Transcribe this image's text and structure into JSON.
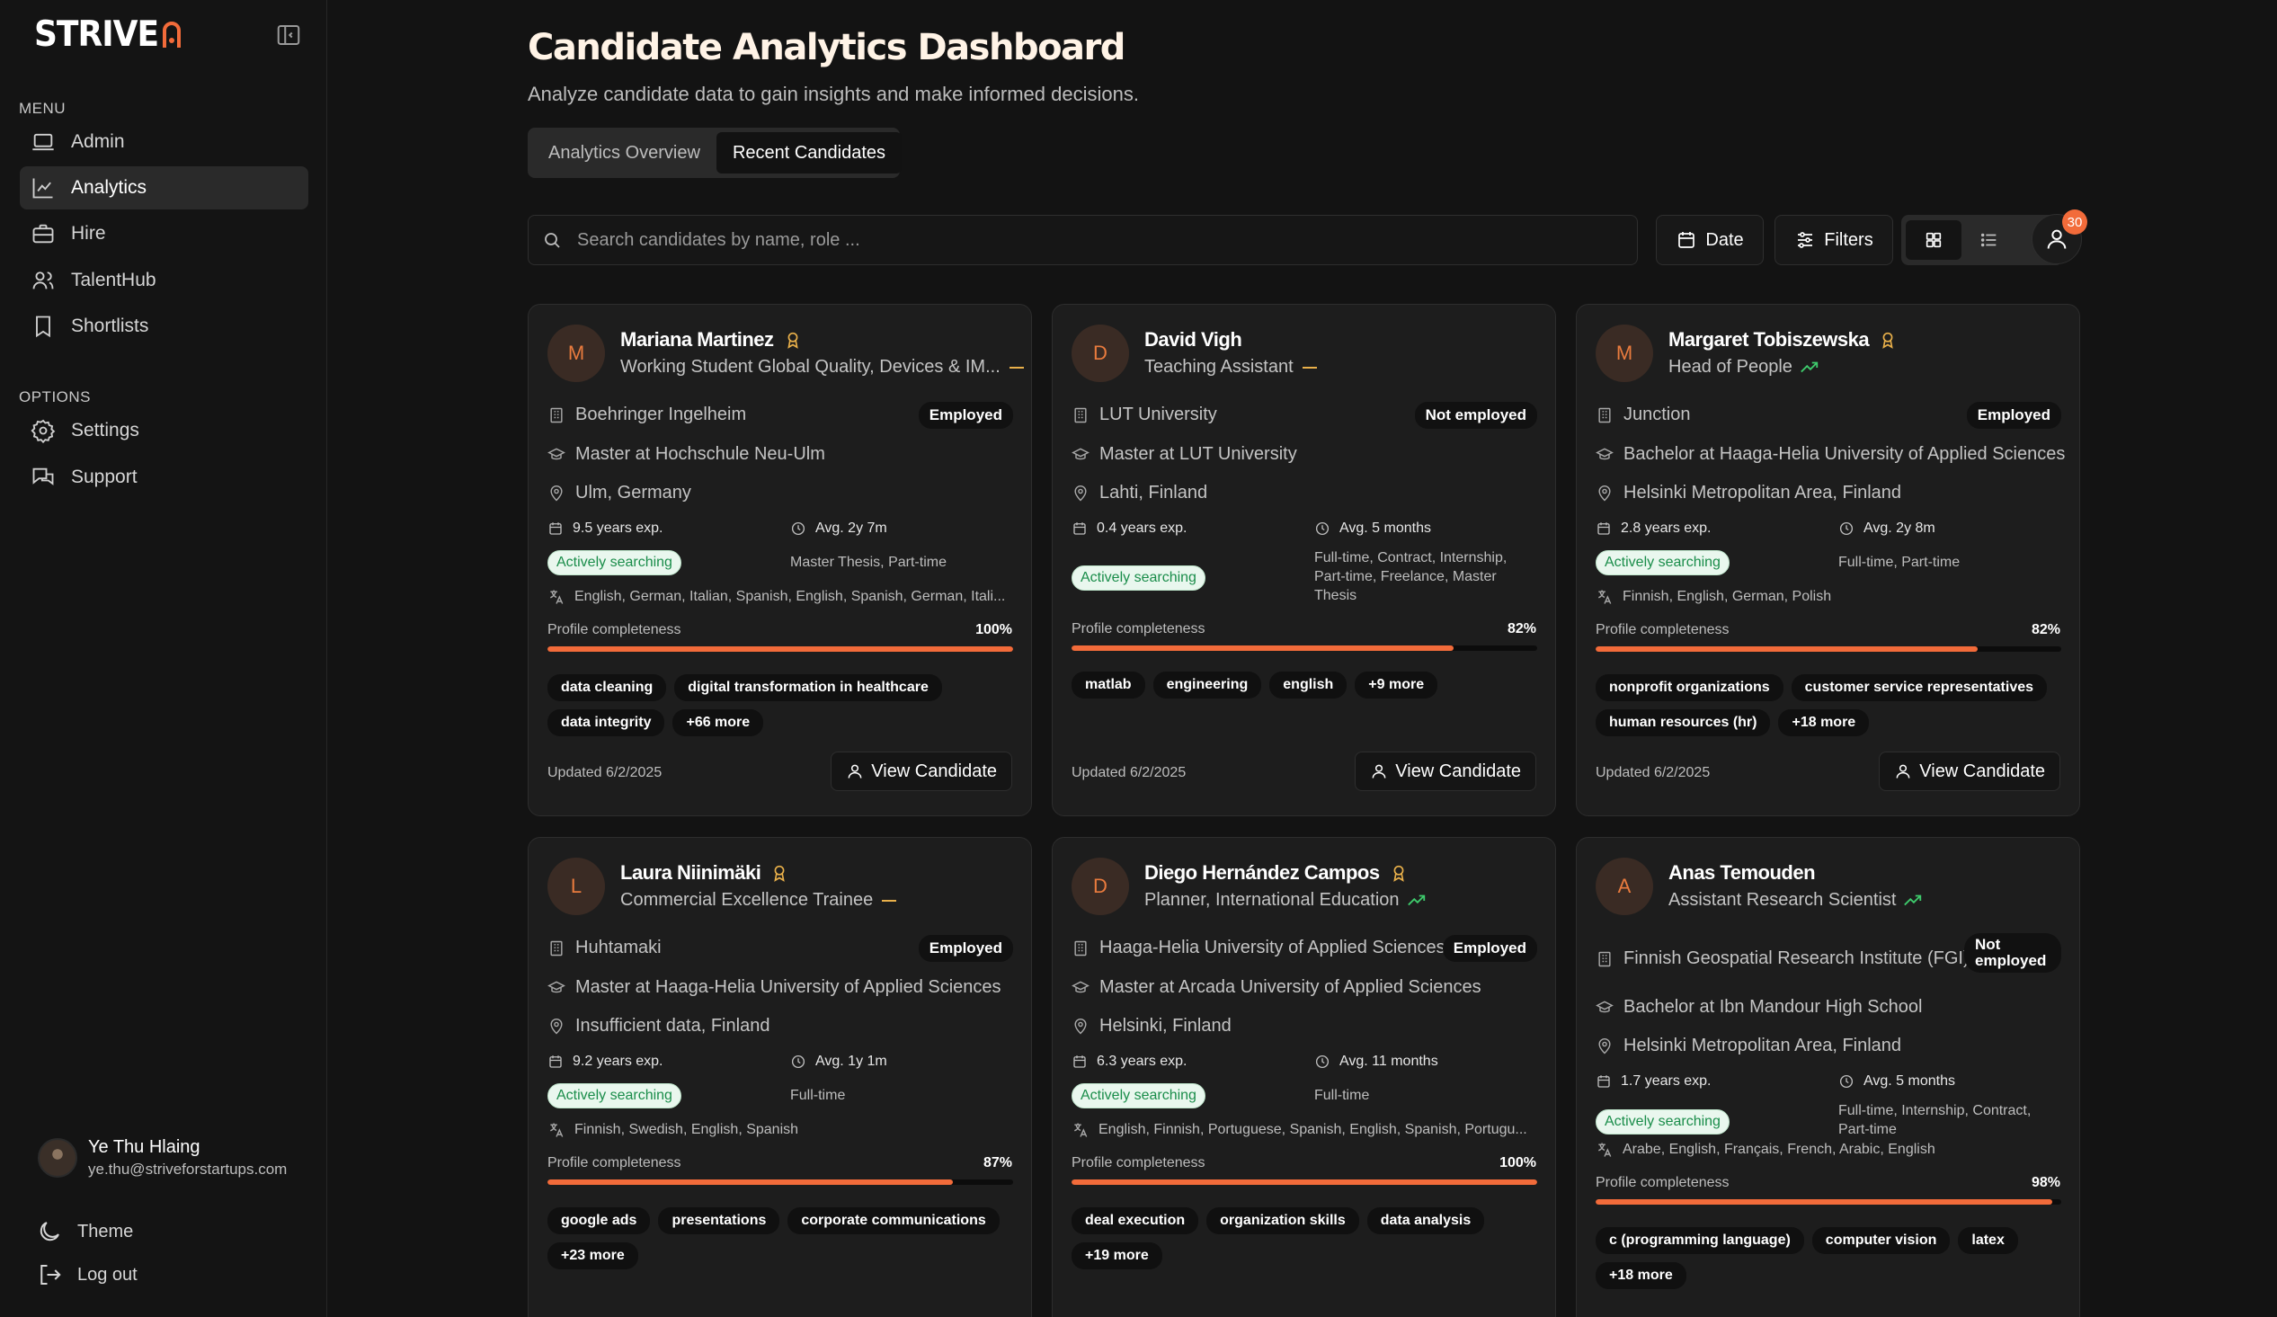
{
  "app": {
    "logo": "STRIVE"
  },
  "sidebar": {
    "menu_label": "MENU",
    "options_label": "OPTIONS",
    "items": [
      {
        "label": "Admin",
        "icon": "laptop-icon",
        "active": false
      },
      {
        "label": "Analytics",
        "icon": "chart-line-icon",
        "active": true
      },
      {
        "label": "Hire",
        "icon": "briefcase-icon",
        "active": false
      },
      {
        "label": "TalentHub",
        "icon": "users-icon",
        "active": false
      },
      {
        "label": "Shortlists",
        "icon": "bookmark-icon",
        "active": false
      }
    ],
    "options": [
      {
        "label": "Settings",
        "icon": "gear-icon"
      },
      {
        "label": "Support",
        "icon": "chat-icon"
      }
    ],
    "user": {
      "name": "Ye Thu Hlaing",
      "email": "ye.thu@striveforstartups.com"
    },
    "theme_label": "Theme",
    "logout_label": "Log out"
  },
  "header": {
    "title": "Candidate Analytics Dashboard",
    "subtitle": "Analyze candidate data to gain insights and make informed decisions.",
    "tabs": [
      {
        "label": "Analytics Overview",
        "active": false
      },
      {
        "label": "Recent Candidates",
        "active": true
      }
    ]
  },
  "toolbar": {
    "search_placeholder": "Search candidates by name, role ...",
    "date_label": "Date",
    "filters_label": "Filters",
    "notification_count": "30"
  },
  "colors": {
    "accent": "#f26b3a",
    "searching_green": "#1a8d4a",
    "award": "#e9b04a"
  },
  "profile_completeness_label": "Profile completeness",
  "view_candidate_label": "View Candidate",
  "candidates": [
    {
      "initial": "M",
      "name": "Mariana Martinez",
      "award": true,
      "role": "Working Student Global Quality, Devices & IM...",
      "trend": "flat",
      "company": "Boehringer Ingelheim",
      "status": "Employed",
      "education": "Master at Hochschule Neu-Ulm",
      "location": "Ulm, Germany",
      "experience": "9.5 years exp.",
      "avg_tenure": "Avg. 2y 7m",
      "searching": "Actively searching",
      "job_types": "Master Thesis, Part-time",
      "languages": "English, German, Italian, Spanish, English, Spanish, German, Itali...",
      "completeness": "100%",
      "completeness_value": 1.0,
      "skills": [
        "data cleaning",
        "digital transformation in healthcare",
        "data integrity",
        "+66 more"
      ],
      "updated": "Updated 6/2/2025"
    },
    {
      "initial": "D",
      "name": "David Vigh",
      "award": false,
      "role": "Teaching Assistant",
      "trend": "flat",
      "company": "LUT University",
      "status": "Not employed",
      "education": "Master at LUT University",
      "location": "Lahti, Finland",
      "experience": "0.4 years exp.",
      "avg_tenure": "Avg. 5 months",
      "searching": "Actively searching",
      "job_types": "Full-time, Contract, Internship, Part-time, Freelance, Master Thesis",
      "languages": "",
      "completeness": "82%",
      "completeness_value": 0.82,
      "skills": [
        "matlab",
        "engineering",
        "english",
        "+9 more"
      ],
      "updated": "Updated 6/2/2025"
    },
    {
      "initial": "M",
      "name": "Margaret Tobiszewska",
      "award": true,
      "role": "Head of People",
      "trend": "up",
      "company": "Junction",
      "status": "Employed",
      "education": "Bachelor at Haaga-Helia University of Applied Sciences",
      "location": "Helsinki Metropolitan Area, Finland",
      "experience": "2.8 years exp.",
      "avg_tenure": "Avg. 2y 8m",
      "searching": "Actively searching",
      "job_types": "Full-time, Part-time",
      "languages": "Finnish, English, German, Polish",
      "completeness": "82%",
      "completeness_value": 0.82,
      "skills": [
        "nonprofit organizations",
        "customer service representatives",
        "human resources (hr)",
        "+18 more"
      ],
      "updated": "Updated 6/2/2025"
    },
    {
      "initial": "L",
      "name": "Laura Niinimäki",
      "award": true,
      "role": "Commercial Excellence Trainee",
      "trend": "flat",
      "company": "Huhtamaki",
      "status": "Employed",
      "education": "Master at Haaga-Helia University of Applied Sciences",
      "location": "Insufficient data, Finland",
      "experience": "9.2 years exp.",
      "avg_tenure": "Avg. 1y 1m",
      "searching": "Actively searching",
      "job_types": "Full-time",
      "languages": "Finnish, Swedish, English, Spanish",
      "completeness": "87%",
      "completeness_value": 0.87,
      "skills": [
        "google ads",
        "presentations",
        "corporate communications",
        "+23 more"
      ],
      "updated": ""
    },
    {
      "initial": "D",
      "name": "Diego Hernández Campos",
      "award": true,
      "role": "Planner, International Education",
      "trend": "up",
      "company": "Haaga-Helia University of Applied Sciences",
      "status": "Employed",
      "education": "Master at Arcada University of Applied Sciences",
      "location": "Helsinki, Finland",
      "experience": "6.3 years exp.",
      "avg_tenure": "Avg. 11 months",
      "searching": "Actively searching",
      "job_types": "Full-time",
      "languages": "English, Finnish, Portuguese, Spanish, English, Spanish, Portugu...",
      "completeness": "100%",
      "completeness_value": 1.0,
      "skills": [
        "deal execution",
        "organization skills",
        "data analysis",
        "+19 more"
      ],
      "updated": ""
    },
    {
      "initial": "A",
      "name": "Anas Temouden",
      "award": false,
      "role": "Assistant Research Scientist",
      "trend": "up",
      "company": "Finnish Geospatial Research Institute (FGI)",
      "status": "Not employed",
      "education": "Bachelor at Ibn Mandour High School",
      "location": "Helsinki Metropolitan Area, Finland",
      "experience": "1.7 years exp.",
      "avg_tenure": "Avg. 5 months",
      "searching": "Actively searching",
      "job_types": "Full-time, Internship, Contract, Part-time",
      "languages": "Arabe, English, Français, French, Arabic, English",
      "completeness": "98%",
      "completeness_value": 0.98,
      "skills": [
        "c (programming language)",
        "computer vision",
        "latex",
        "+18 more"
      ],
      "updated": ""
    }
  ]
}
